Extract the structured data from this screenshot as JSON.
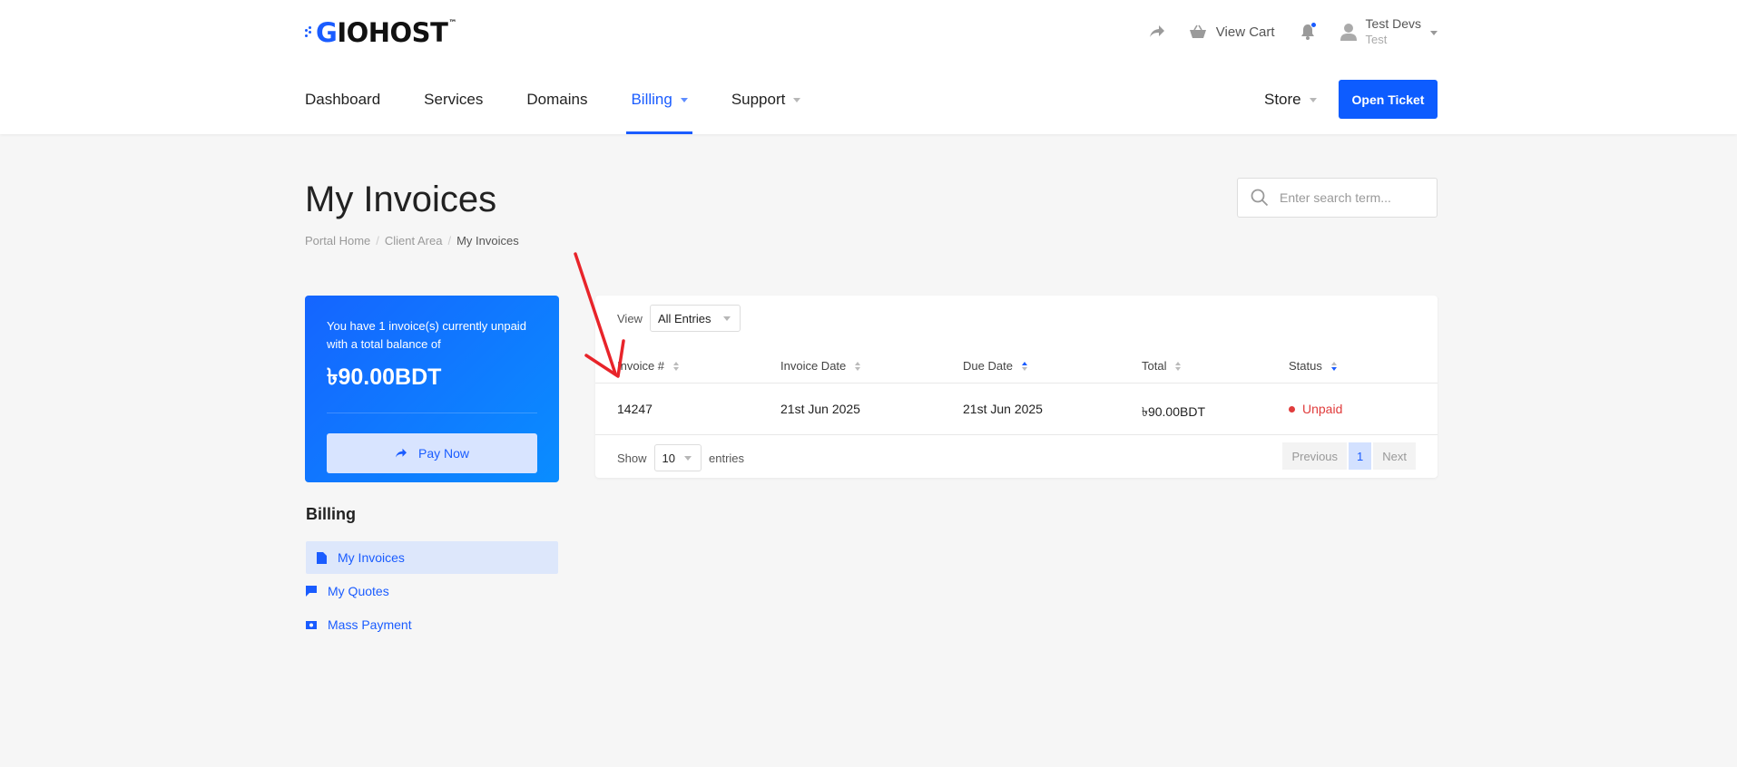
{
  "brand": {
    "logo_text": "GIOHOST",
    "logo_first": "G",
    "trademark": "™",
    "accent": "#1a5cff"
  },
  "topbar": {
    "cart_label": "View Cart",
    "user_name": "Test Devs",
    "user_sub": "Test"
  },
  "nav": {
    "items": [
      {
        "label": "Dashboard"
      },
      {
        "label": "Services"
      },
      {
        "label": "Domains"
      },
      {
        "label": "Billing"
      },
      {
        "label": "Support"
      }
    ],
    "store_label": "Store",
    "open_ticket_label": "Open Ticket"
  },
  "page": {
    "title": "My Invoices",
    "breadcrumb": [
      "Portal Home",
      "Client Area",
      "My Invoices"
    ],
    "search_placeholder": "Enter search term..."
  },
  "balance": {
    "message": "You have 1 invoice(s) currently unpaid with a total balance of",
    "amount": "৳90.00BDT",
    "pay_label": "Pay Now"
  },
  "sidebar": {
    "title": "Billing",
    "items": [
      {
        "label": "My Invoices"
      },
      {
        "label": "My Quotes"
      },
      {
        "label": "Mass Payment"
      }
    ]
  },
  "table": {
    "view_label": "View",
    "view_value": "All Entries",
    "columns": [
      "Invoice #",
      "Invoice Date",
      "Due Date",
      "Total",
      "Status"
    ],
    "rows": [
      {
        "invoice": "14247",
        "invoice_date": "21st Jun 2025",
        "due_date": "21st Jun 2025",
        "total": "৳90.00BDT",
        "status": "Unpaid"
      }
    ],
    "show_label": "Show",
    "show_value": "10",
    "entries_label": "entries",
    "pager": {
      "previous": "Previous",
      "current": "1",
      "next": "Next"
    }
  }
}
